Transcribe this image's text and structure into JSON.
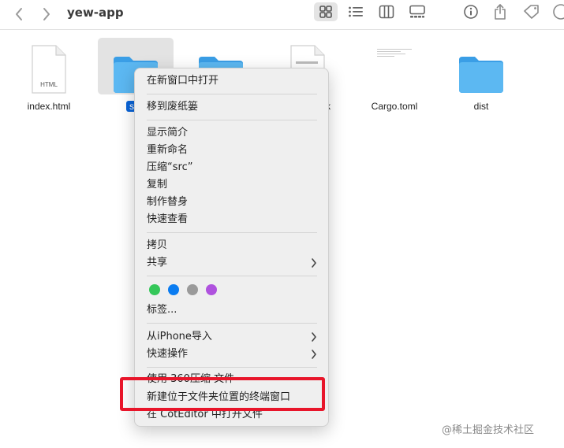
{
  "window": {
    "title": "yew-app"
  },
  "toolbar": {
    "icons": [
      "chevron-left-icon",
      "chevron-right-icon",
      "icon-grid-view-icon",
      "list-view-icon",
      "column-view-icon",
      "gallery-view-icon",
      "info-icon",
      "share-icon",
      "tag-icon",
      "more-icon"
    ]
  },
  "files": [
    {
      "name": "index.html",
      "type": "html",
      "badge": "HTML"
    },
    {
      "name": "src",
      "type": "folder",
      "selected": true
    },
    {
      "name": "",
      "type": "folder"
    },
    {
      "name": "k",
      "type": "document"
    },
    {
      "name": "Cargo.toml",
      "type": "toml"
    },
    {
      "name": "dist",
      "type": "folder"
    }
  ],
  "context_menu": {
    "open_in_new_window": "在新窗口中打开",
    "move_to_trash": "移到废纸篓",
    "get_info": "显示简介",
    "rename": "重新命名",
    "compress": "压缩“src”",
    "duplicate": "复制",
    "make_alias": "制作替身",
    "quick_look": "快速查看",
    "copy": "拷贝",
    "share": "共享",
    "tags_label": "标签...",
    "tag_colors": [
      "#34c759",
      "#0a7cf1",
      "#9a9a9a",
      "#af52de"
    ],
    "import_from_iphone": "从iPhone导入",
    "quick_actions": "快速操作",
    "compress_360": "使用 360压缩 文件",
    "new_terminal": "新建位于文件夹位置的终端窗口",
    "open_in_coteditor": "在 CotEditor 中打开文件"
  },
  "colors": {
    "accent": "#0a64d8",
    "folder": "#4fb0f0",
    "highlight": "#e8152a"
  },
  "watermark": "@稀土掘金技术社区"
}
